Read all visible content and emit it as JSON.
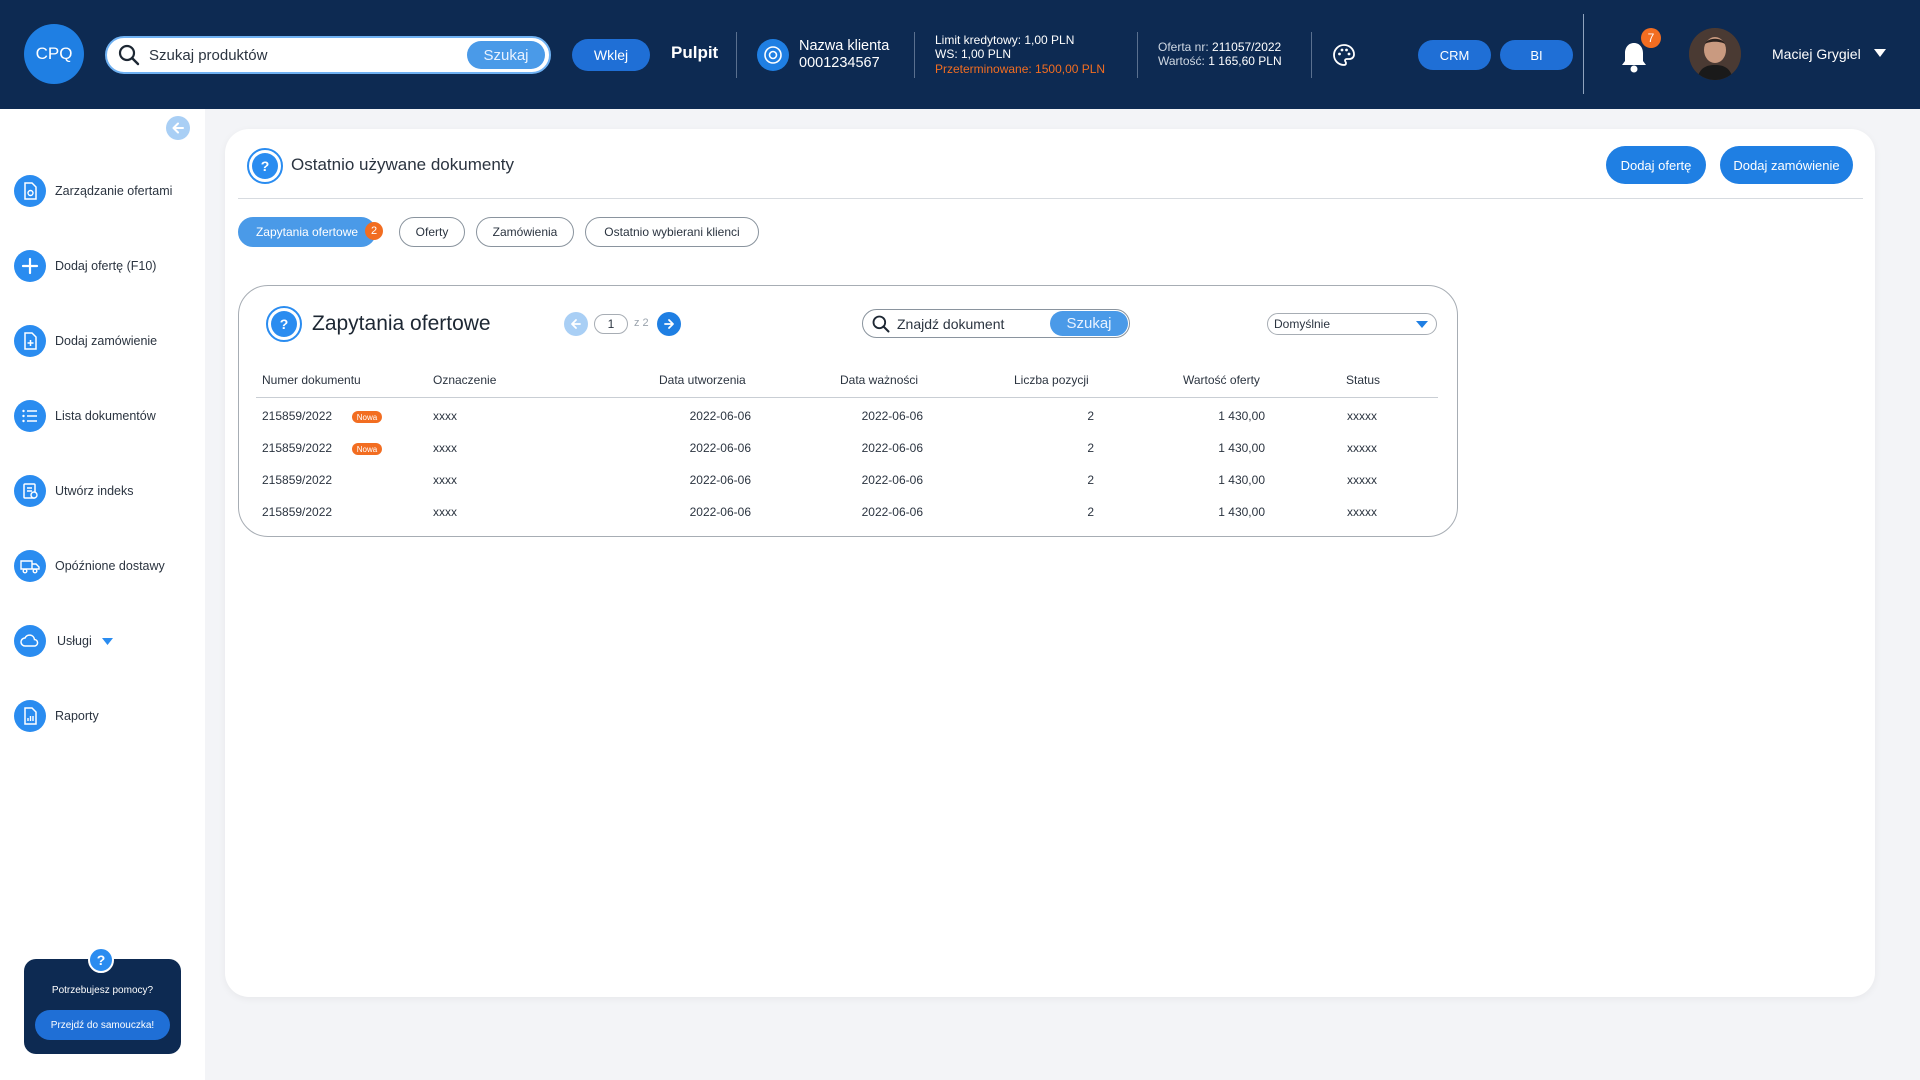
{
  "header": {
    "logo": "CPQ",
    "search_placeholder": "Szukaj produktów",
    "search_button": "Szukaj",
    "paste_button": "Wklej",
    "dashboard": "Pulpit",
    "client_name_label": "Nazwa klienta",
    "client_number": "0001234567",
    "credit_limit": "Limit kredytowy: 1,00 PLN",
    "ws": "WS: 1,00 PLN",
    "overdue": "Przeterminowane: 1500,00 PLN",
    "offer_number_label": "Oferta nr:",
    "offer_number": "211057/2022",
    "offer_value_label": "Wartość:",
    "offer_value": "1 165,60 PLN",
    "crm_button": "CRM",
    "bi_button": "BI",
    "notifications_count": "7",
    "user_name": "Maciej Grygiel"
  },
  "sidebar": {
    "items": [
      {
        "label": "Zarządzanie ofertami",
        "icon": "document-settings-icon"
      },
      {
        "label": "Dodaj ofertę (F10)",
        "icon": "plus-icon"
      },
      {
        "label": "Dodaj zamówienie",
        "icon": "add-document-icon"
      },
      {
        "label": "Lista dokumentów",
        "icon": "list-icon"
      },
      {
        "label": "Utwórz indeks",
        "icon": "create-index-icon"
      },
      {
        "label": "Opóźnione dostawy",
        "icon": "truck-icon"
      },
      {
        "label": "Usługi",
        "icon": "cloud-icon"
      },
      {
        "label": "Raporty",
        "icon": "report-icon"
      }
    ],
    "help_title": "Potrzebujesz pomocy?",
    "help_button": "Przejdź do samouczka!"
  },
  "main": {
    "title": "Ostatnio używane dokumenty",
    "add_offer_button": "Dodaj ofertę",
    "add_order_button": "Dodaj zamówienie",
    "tabs": [
      {
        "label": "Zapytania ofertowe",
        "active": true,
        "badge": "2"
      },
      {
        "label": "Oferty",
        "active": false
      },
      {
        "label": "Zamówienia",
        "active": false
      },
      {
        "label": "Ostatnio wybierani klienci",
        "active": false
      }
    ],
    "panel": {
      "title": "Zapytania ofertowe",
      "page_current": "1",
      "page_of": "z 2",
      "search_placeholder": "Znajdź dokument",
      "search_button": "Szukaj",
      "sort_selected": "Domyślnie",
      "columns": [
        "Numer dokumentu",
        "Oznaczenie",
        "Data utworzenia",
        "Data ważności",
        "Liczba pozycji",
        "Wartość oferty",
        "Status"
      ],
      "new_badge": "Nowa",
      "rows": [
        {
          "number": "215859/2022",
          "is_new": true,
          "mark": "xxxx",
          "created": "2022-06-06",
          "valid": "2022-06-06",
          "count": "2",
          "value": "1 430,00",
          "status": "xxxxx"
        },
        {
          "number": "215859/2022",
          "is_new": true,
          "mark": "xxxx",
          "created": "2022-06-06",
          "valid": "2022-06-06",
          "count": "2",
          "value": "1 430,00",
          "status": "xxxxx"
        },
        {
          "number": "215859/2022",
          "is_new": false,
          "mark": "xxxx",
          "created": "2022-06-06",
          "valid": "2022-06-06",
          "count": "2",
          "value": "1 430,00",
          "status": "xxxxx"
        },
        {
          "number": "215859/2022",
          "is_new": false,
          "mark": "xxxx",
          "created": "2022-06-06",
          "valid": "2022-06-06",
          "count": "2",
          "value": "1 430,00",
          "status": "xxxxx"
        }
      ]
    }
  },
  "colors": {
    "header_bg": "#0d2a52",
    "accent": "#1f7fe3",
    "badge": "#f26d21"
  }
}
